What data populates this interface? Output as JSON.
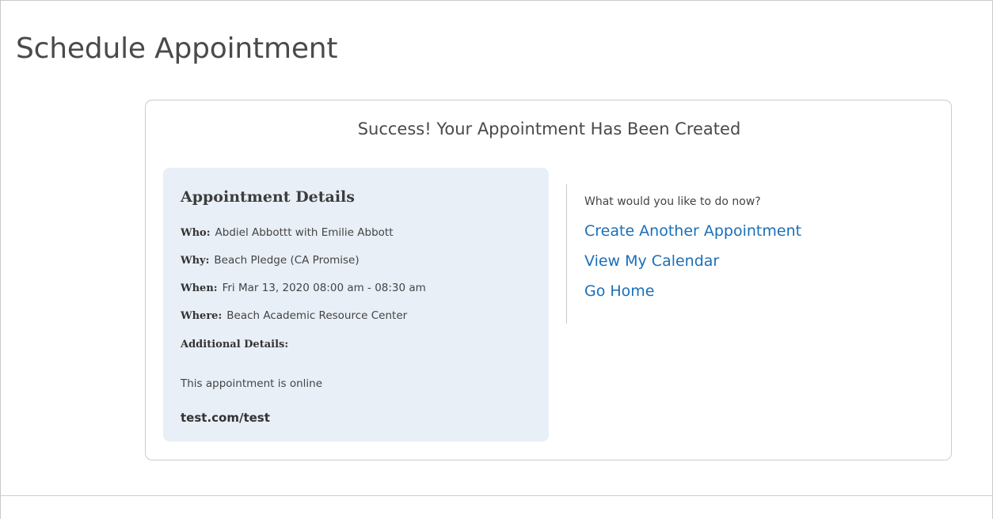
{
  "page": {
    "title": "Schedule Appointment"
  },
  "confirmation": {
    "title": "Success! Your Appointment Has Been Created"
  },
  "details": {
    "heading": "Appointment Details",
    "who_label": "Who:",
    "who_value": "Abdiel Abbottt with Emilie Abbott",
    "why_label": "Why:",
    "why_value": "Beach Pledge (CA Promise)",
    "when_label": "When:",
    "when_value": "Fri Mar 13, 2020 08:00 am - 08:30 am",
    "where_label": "Where:",
    "where_value": "Beach Academic Resource Center",
    "additional_label": "Additional Details:",
    "additional_note": "This appointment is online",
    "additional_link": "test.com/test"
  },
  "actions": {
    "prompt": "What would you like to do now?",
    "links": [
      {
        "label": "Create Another Appointment"
      },
      {
        "label": "View My Calendar"
      },
      {
        "label": "Go Home"
      }
    ]
  },
  "colors": {
    "link": "#1a6fb7",
    "details_background": "#e8eff7",
    "card_border": "#cccccc",
    "title_text": "#4a4a4a"
  }
}
